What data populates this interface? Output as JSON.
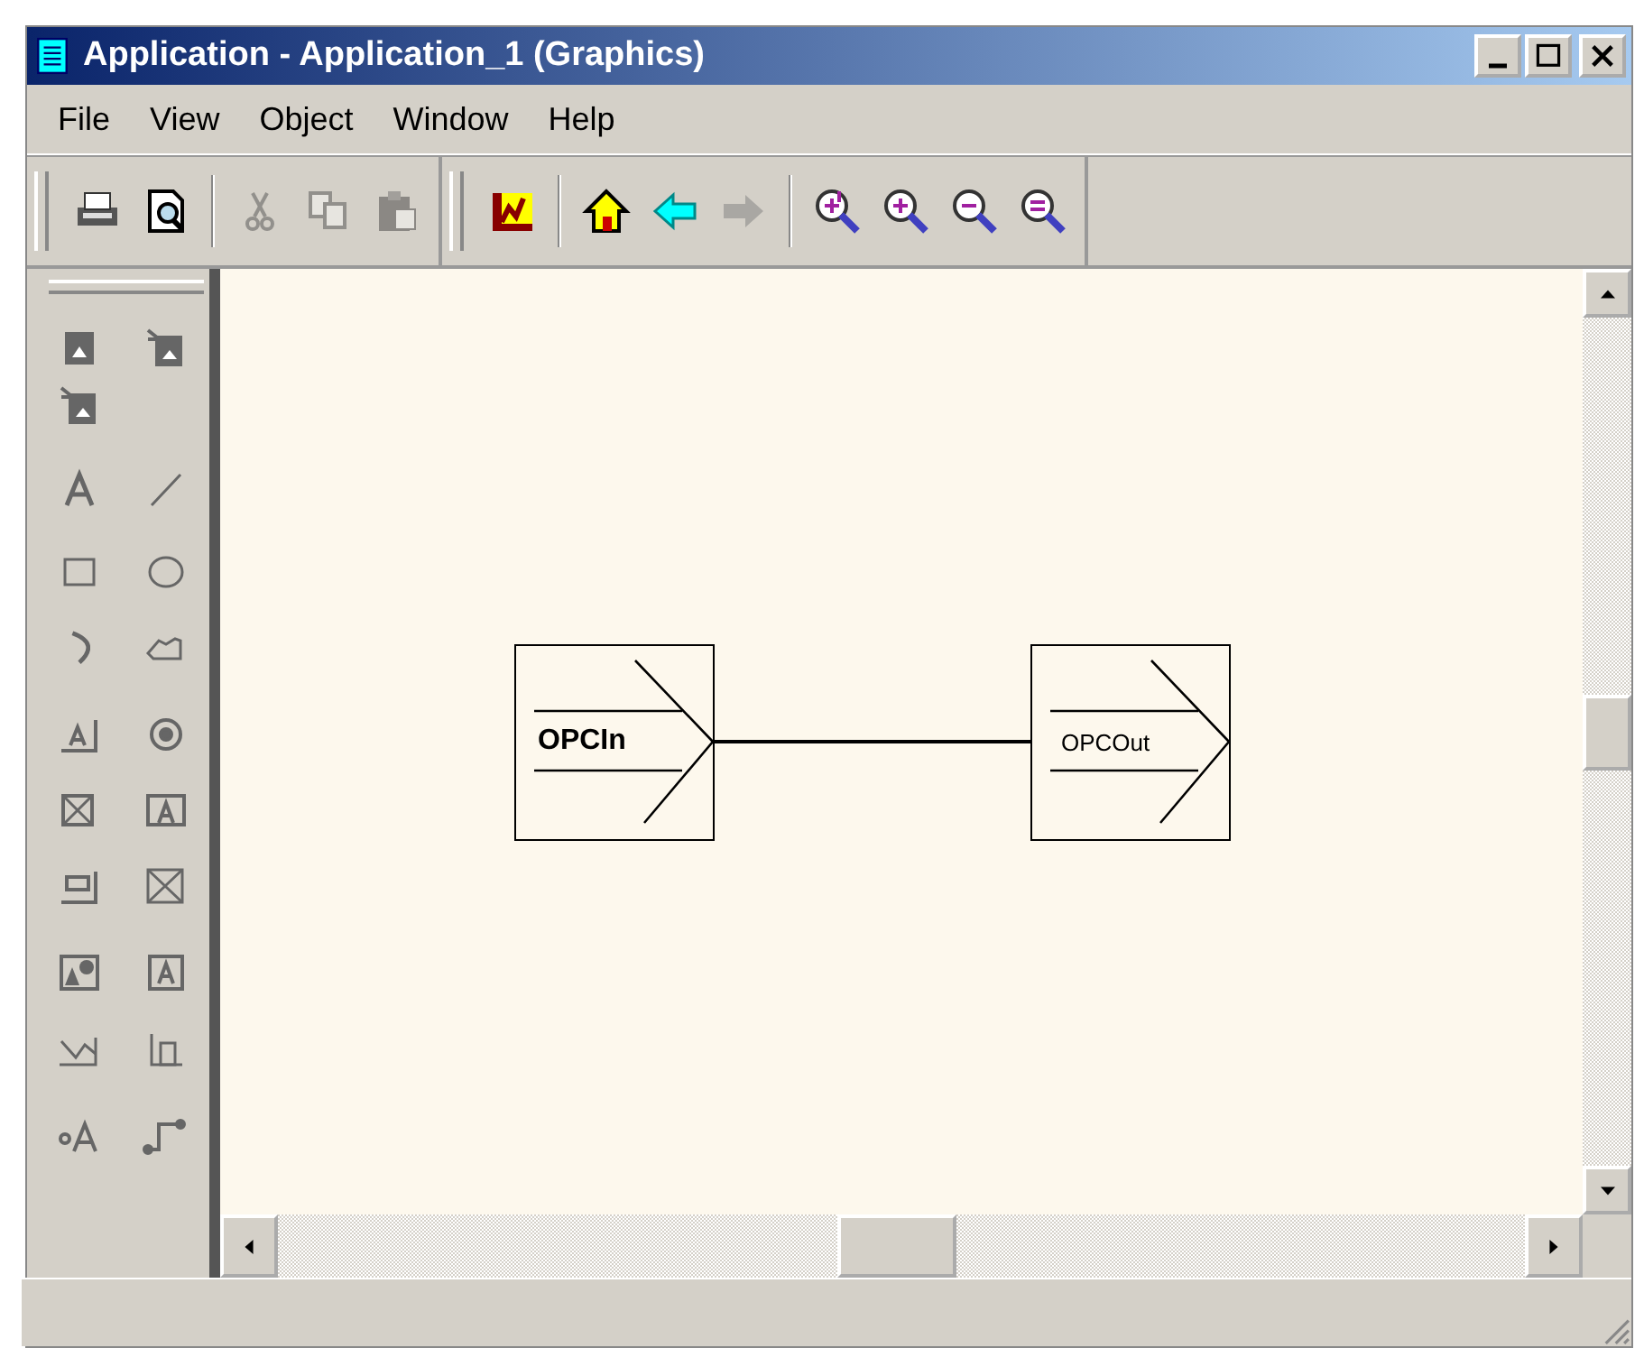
{
  "window": {
    "title": "Application - Application_1 (Graphics)"
  },
  "menu": [
    {
      "label": "File"
    },
    {
      "label": "View"
    },
    {
      "label": "Object"
    },
    {
      "label": "Window"
    },
    {
      "label": "Help"
    }
  ],
  "toolbar": [
    {
      "disabled": false
    },
    {
      "disabled": false
    },
    {
      "disabled": true
    },
    {
      "disabled": true
    },
    {
      "disabled": true
    },
    {
      "disabled": false
    },
    {
      "disabled": false
    },
    {
      "disabled": false
    },
    {
      "disabled": true
    },
    {
      "disabled": false
    },
    {
      "disabled": false
    },
    {
      "disabled": false
    },
    {
      "disabled": false
    }
  ],
  "diagram": {
    "nodes": [
      {
        "kind": "input",
        "label": "OPCIn"
      },
      {
        "kind": "output",
        "label": "OPCOut"
      }
    ]
  }
}
